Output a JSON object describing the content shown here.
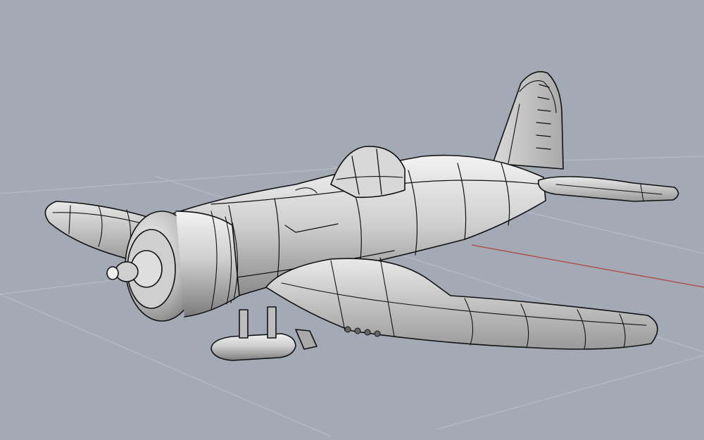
{
  "viewport": {
    "background": "#a3aab5",
    "grid_line": "#b9bec7",
    "axis_x_color": "#b0463f",
    "axis_y_color": "#7a9a78"
  },
  "model": {
    "icon": "corsair-aircraft-model-icon",
    "shade_light": "#eeeeee",
    "shade_mid": "#bdbdbd",
    "shade_dark": "#7a7a7a",
    "edge": "#111111"
  }
}
